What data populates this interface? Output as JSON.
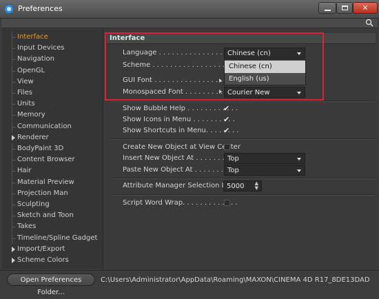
{
  "window": {
    "title": "Preferences",
    "close_glyph": "✕",
    "icons": [
      "cinema4d-logo-icon",
      "minimize-icon",
      "maximize-icon",
      "close-icon"
    ]
  },
  "toolbar": {
    "search_icon": "search-icon"
  },
  "sidebar": {
    "items": [
      {
        "label": "Interface",
        "active": true
      },
      {
        "label": "Input Devices"
      },
      {
        "label": "Navigation"
      },
      {
        "label": "OpenGL"
      },
      {
        "label": "View"
      },
      {
        "label": "Files"
      },
      {
        "label": "Units"
      },
      {
        "label": "Memory"
      },
      {
        "label": "Communication"
      },
      {
        "label": "Renderer",
        "expandable": true
      },
      {
        "label": "BodyPaint 3D"
      },
      {
        "label": "Content Browser"
      },
      {
        "label": "Hair"
      },
      {
        "label": "Material Preview"
      },
      {
        "label": "Projection Man"
      },
      {
        "label": "Sculpting"
      },
      {
        "label": "Sketch and Toon"
      },
      {
        "label": "Takes"
      },
      {
        "label": "Timeline/Spline Gadget"
      },
      {
        "label": "Import/Export",
        "expandable": true
      },
      {
        "label": "Scheme Colors",
        "expandable": true
      }
    ],
    "accent_color": "#f29a1f"
  },
  "main": {
    "section_title": "Interface",
    "language": {
      "label": "Language . . . . . . . . . . . . . . . . . . .",
      "value": "Chinese (cn)"
    },
    "scheme": {
      "label": "Scheme . . . . . . . . . . . . . . . . . . . ."
    },
    "gui_font": {
      "label": "GUI Font . . . . . . . . . . . . . . . . . ."
    },
    "mono_font": {
      "label": "Monospaced Font . . . . . . . . . . . .",
      "value": "Courier New"
    },
    "dropdown_options": [
      "Chinese (cn)",
      "English (us)"
    ],
    "show_bubble_help": {
      "label": "Show Bubble Help . . . . . . . . . . . .",
      "checked": true
    },
    "show_icons_menu": {
      "label": "Show Icons in Menu . . . . . . . . . .",
      "checked": true
    },
    "show_shortcuts": {
      "label": "Show Shortcuts in Menu. . . . . . . .",
      "checked": true
    },
    "create_new_object": {
      "label": "Create New Object at View Center",
      "checked": false
    },
    "insert_new_object": {
      "label": "Insert New Object At . . . . . . . . .",
      "value": "Top"
    },
    "paste_new_object": {
      "label": "Paste New Object At . . . . . . . . . .",
      "value": "Top"
    },
    "attr_limit": {
      "label": "Attribute Manager Selection Limit",
      "value": "5000"
    },
    "script_word_wrap": {
      "label": "Script Word Wrap. . . . . . . . . . . . .",
      "checked": false
    },
    "check_glyph": "✔",
    "highlight_color": "#e0203a"
  },
  "footer": {
    "open_button": "Open Preferences Folder...",
    "path": "C:\\Users\\Administrator\\AppData\\Roaming\\MAXON\\CINEMA 4D R17_8DE13DAD"
  }
}
